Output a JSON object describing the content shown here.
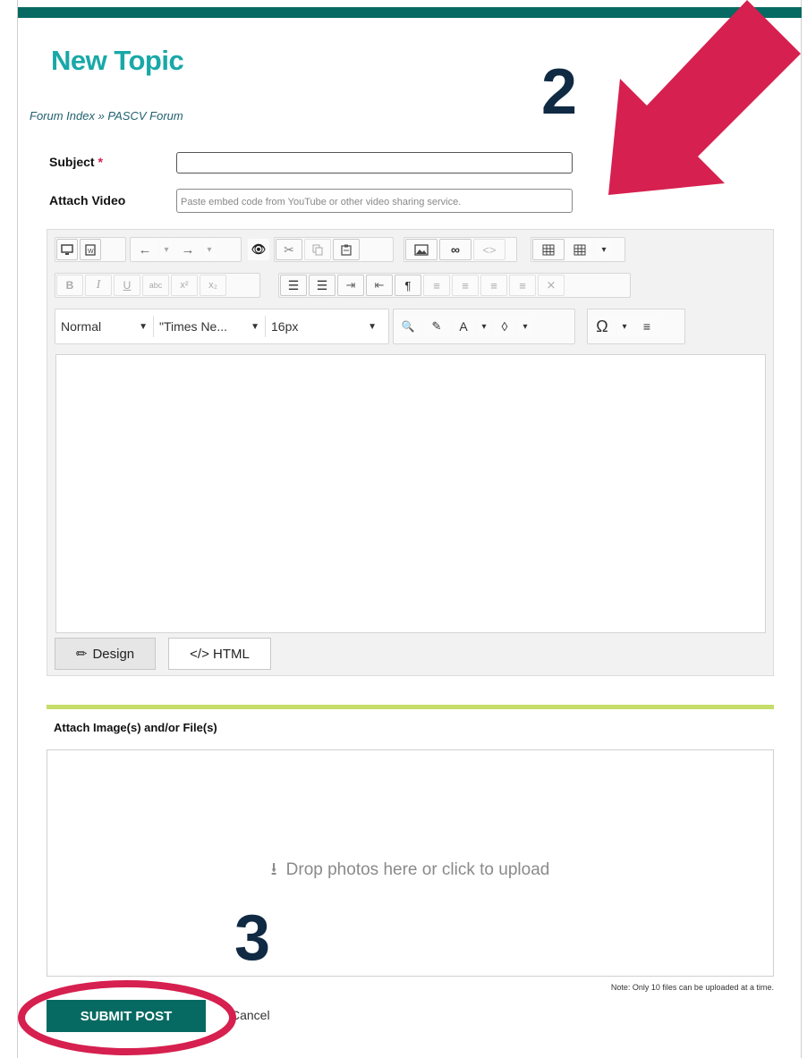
{
  "page": {
    "title": "New Topic",
    "breadcrumb": "Forum Index » PASCV Forum"
  },
  "form": {
    "subject_label": "Subject",
    "subject_required": "*",
    "subject_value": "",
    "video_label": "Attach Video",
    "video_placeholder": "Paste embed code from YouTube or other video sharing service.",
    "video_value": ""
  },
  "toolbar": {
    "format_value": "Normal",
    "font_value": "\"Times Ne...",
    "size_value": "16px",
    "bold": "B",
    "italic": "I",
    "underline": "U",
    "strike": "abc",
    "superscript": "x²",
    "subscript": "x₂",
    "font_color": "A",
    "special_char": "Ω"
  },
  "editor": {
    "design_tab": "Design",
    "html_tab": "</> HTML"
  },
  "attachments": {
    "heading": "Attach Image(s) and/or File(s)",
    "drop_text": "Drop photos here or click to upload",
    "note": "Note: Only 10 files can be uploaded at a time."
  },
  "actions": {
    "submit_label": "SUBMIT POST",
    "cancel_label": "Cancel"
  },
  "annotations": {
    "step_two": "2",
    "step_three": "3"
  },
  "colors": {
    "brand_teal": "#066a62",
    "title_teal": "#19a8a8",
    "accent_pink": "#d6204f",
    "divider_green": "#c5dd69"
  }
}
